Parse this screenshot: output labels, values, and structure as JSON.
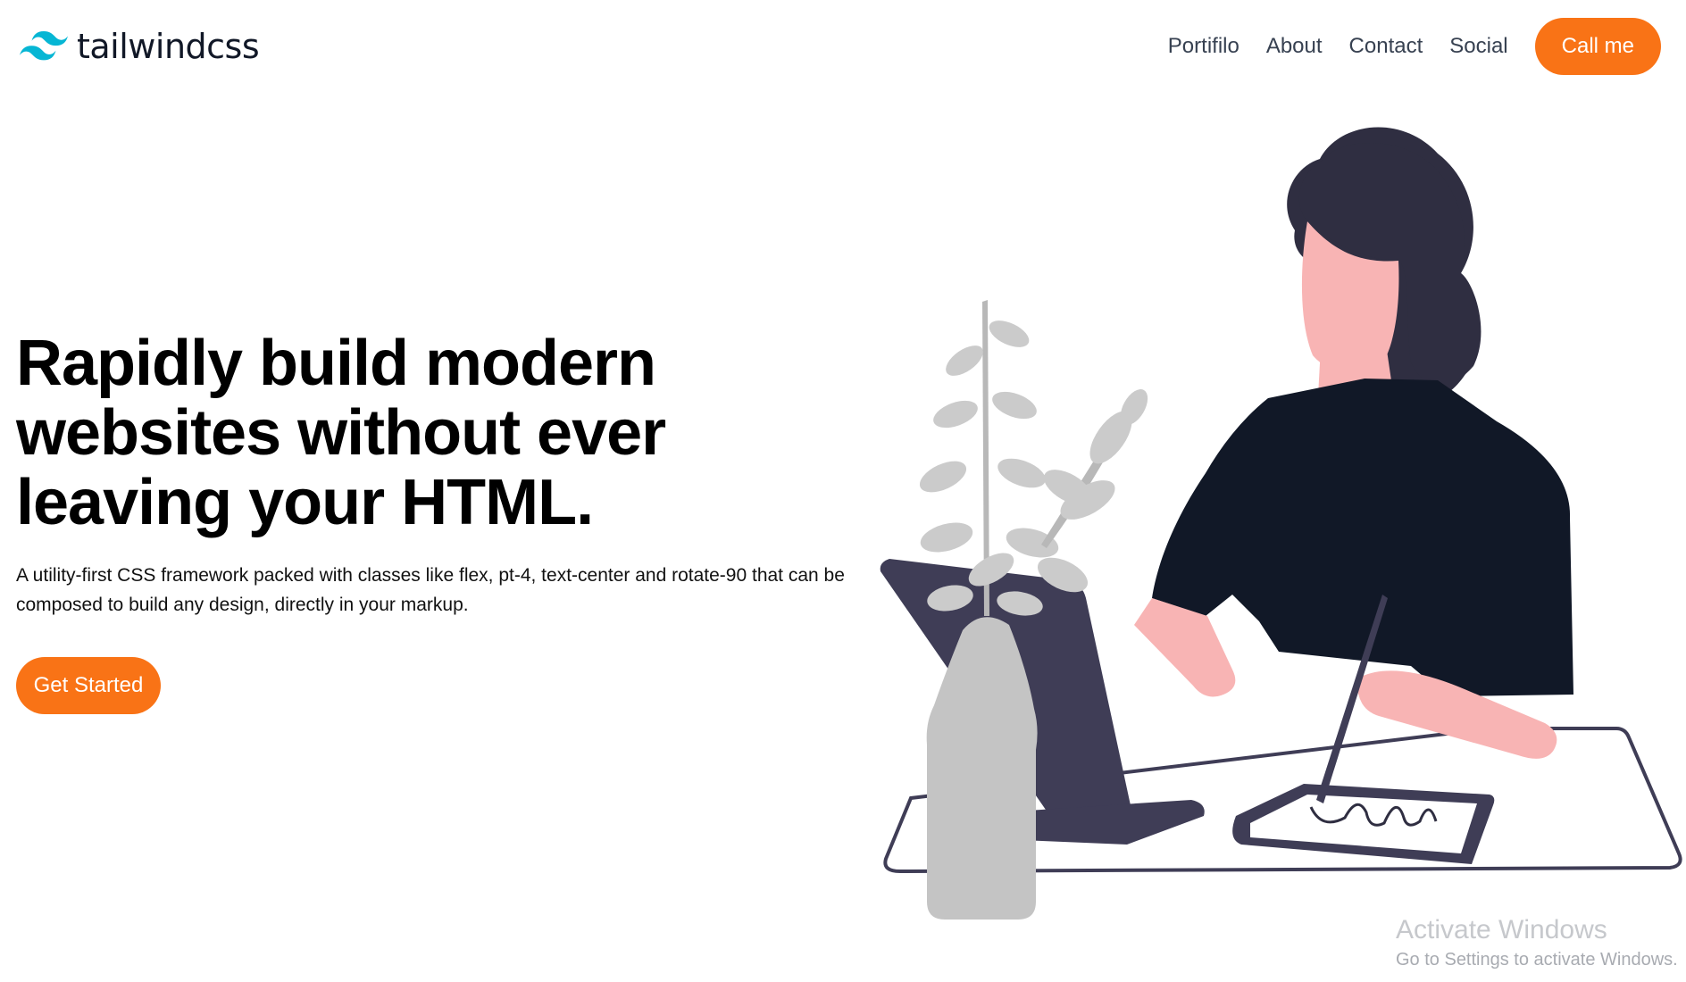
{
  "header": {
    "logo_text": "tailwindcss",
    "nav": [
      "Portifilo",
      "About",
      "Contact",
      "Social"
    ],
    "cta_label": "Call me"
  },
  "hero": {
    "title": "Rapidly build modern websites without ever leaving your HTML.",
    "description": "A utility-first CSS framework packed with classes like flex, pt-4, text-center and rotate-90 that can be composed to build any design, directly in your markup.",
    "button_label": "Get Started"
  },
  "watermark": {
    "title": "Activate Windows",
    "subtitle": "Go to Settings to activate Windows."
  },
  "colors": {
    "accent": "#f97316",
    "logo": "#06b6d4"
  },
  "icons": {
    "logo": "tailwind-logo-icon"
  }
}
